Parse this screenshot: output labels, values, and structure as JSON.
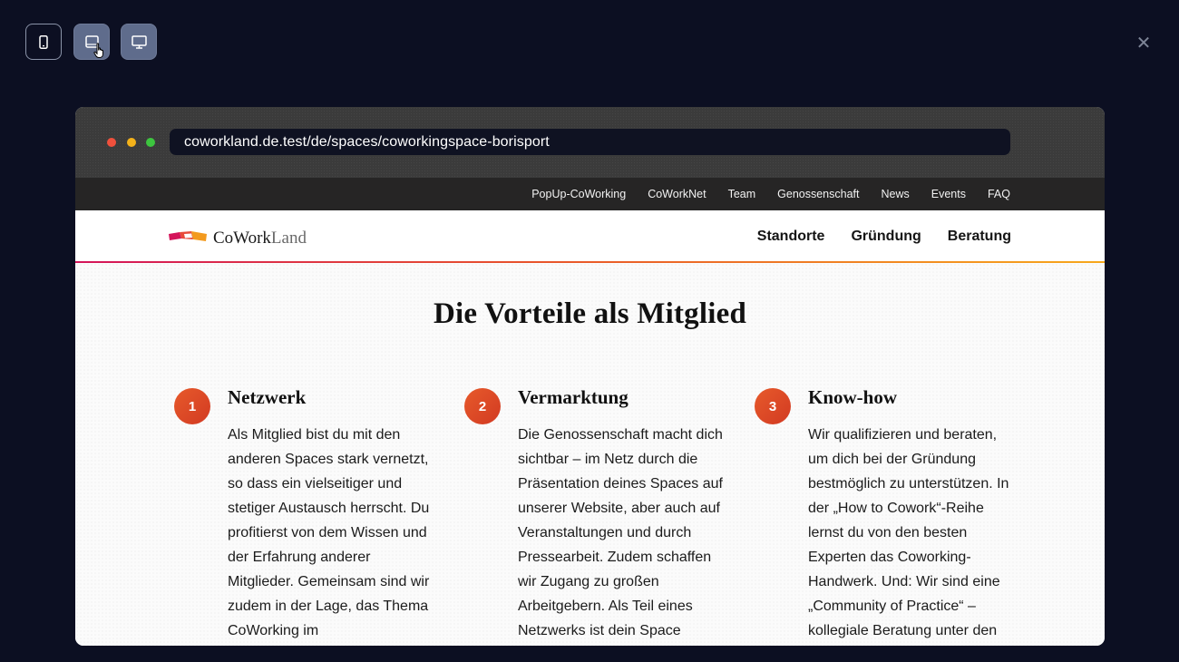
{
  "preview_toolbar": {
    "buttons": [
      {
        "name": "mobile",
        "icon": "mobile-icon"
      },
      {
        "name": "tablet",
        "icon": "tablet-icon",
        "active": true
      },
      {
        "name": "desktop",
        "icon": "desktop-icon"
      }
    ],
    "close_icon": "close-icon",
    "close_glyph": "✕"
  },
  "browser": {
    "url": "coworkland.de.test/de/spaces/coworkingspace-borisport"
  },
  "site": {
    "topbar_links": [
      "PopUp-CoWorking",
      "CoWorkNet",
      "Team",
      "Genossenschaft",
      "News",
      "Events",
      "FAQ"
    ],
    "logo": {
      "text_main": "CoWork",
      "text_light": "Land"
    },
    "main_nav": [
      "Standorte",
      "Gründung",
      "Beratung"
    ],
    "section_title": "Die Vorteile als Mitglied",
    "features": [
      {
        "number": "1",
        "title": "Netzwerk",
        "text": "Als Mitglied bist du mit den anderen Spaces stark vernetzt, so dass ein vielseitiger und stetiger Austausch herrscht. Du profitierst von dem Wissen und der Erfahrung anderer Mitglieder. Gemeinsam sind wir zudem in der Lage, das Thema CoWorking im"
      },
      {
        "number": "2",
        "title": "Vermarktung",
        "text": "Die Genossenschaft macht dich sichtbar – im Netz durch die Präsentation deines Spaces auf unserer Website, aber auch auf Veranstaltungen und durch Pressearbeit. Zudem schaffen wir Zugang zu großen Arbeitgebern. Als Teil eines Netzwerks ist dein Space"
      },
      {
        "number": "3",
        "title": "Know-how",
        "text": "Wir qualifizieren und beraten, um dich bei der Gründung bestmöglich zu unterstützen. In der „How to Cowork“-Reihe lernst du von den besten Experten das Coworking-Handwerk. Und: Wir sind eine „Community of Practice“ – kollegiale Beratung unter den"
      }
    ]
  },
  "colors": {
    "background": "#0c0f22",
    "accent_orange": "#e75a2b",
    "brand_red": "#d4145a",
    "brand_yellow": "#f7a81b"
  }
}
